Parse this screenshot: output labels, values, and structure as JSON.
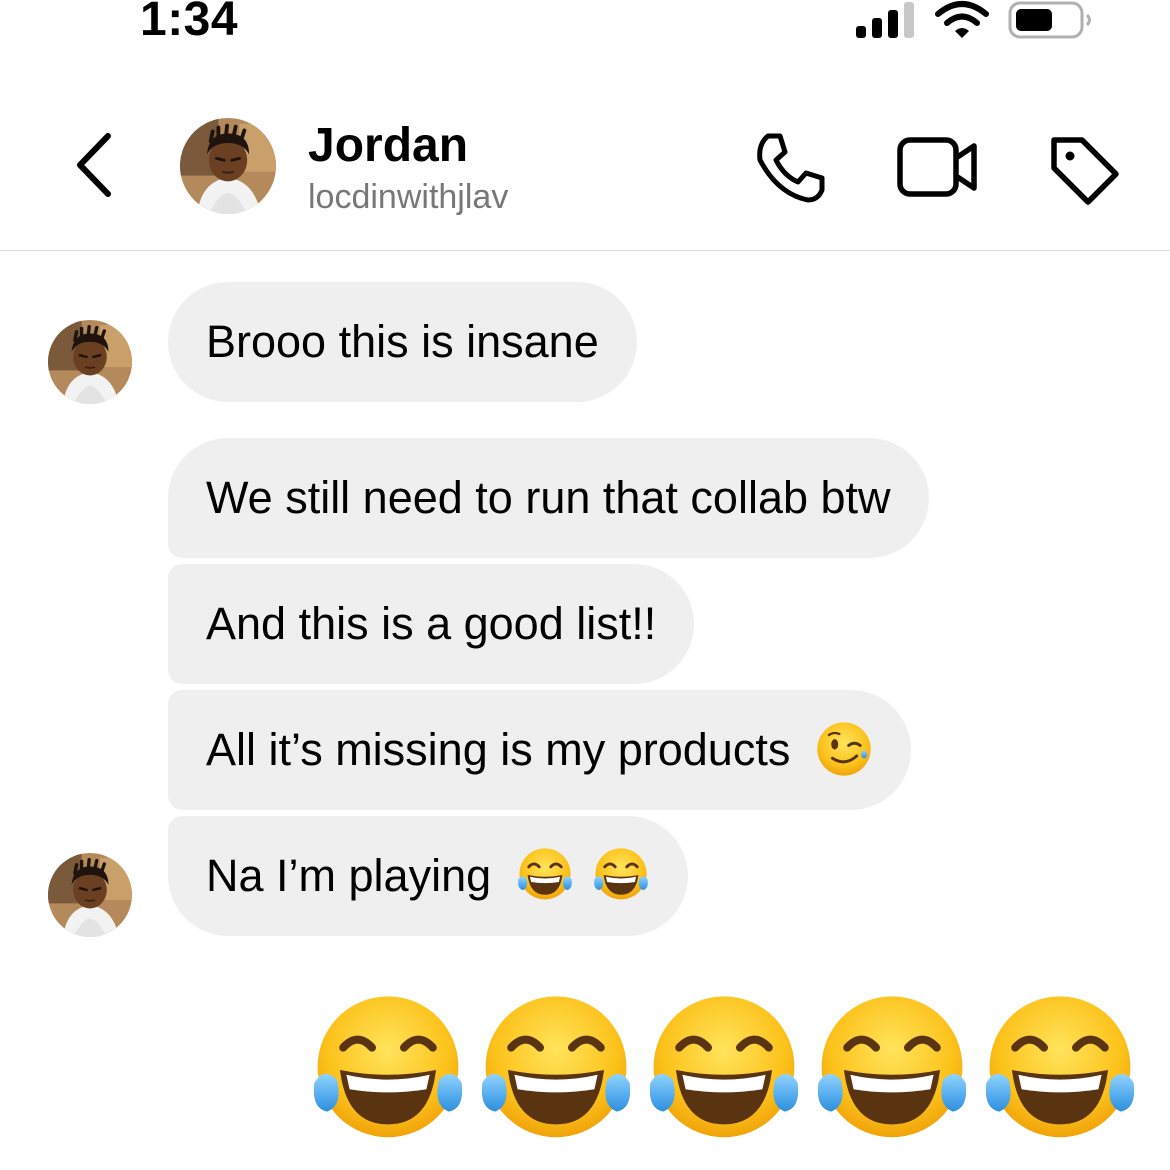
{
  "status_bar": {
    "time": "1:34"
  },
  "header": {
    "contact_name": "Jordan",
    "contact_handle": "locdinwithjlav",
    "icons": [
      "chevron-left-icon",
      "phone-icon",
      "video-camera-icon",
      "tag-icon"
    ]
  },
  "messages": [
    {
      "text": "Brooo this is insane",
      "emoji": []
    },
    {
      "text": "We still need to run that collab btw",
      "emoji": []
    },
    {
      "text": "And this is a good list!!",
      "emoji": []
    },
    {
      "text": "All it’s missing is my products",
      "emoji": [
        "winking-face"
      ]
    },
    {
      "text": "Na I’m playing",
      "emoji": [
        "face-with-tears-of-joy",
        "face-with-tears-of-joy"
      ]
    }
  ],
  "reply": {
    "emoji": [
      "face-with-tears-of-joy",
      "face-with-tears-of-joy",
      "face-with-tears-of-joy",
      "face-with-tears-of-joy",
      "face-with-tears-of-joy"
    ]
  },
  "colors": {
    "bubble": "#efefef",
    "handle": "#777777",
    "divider": "#dcdcdc"
  }
}
